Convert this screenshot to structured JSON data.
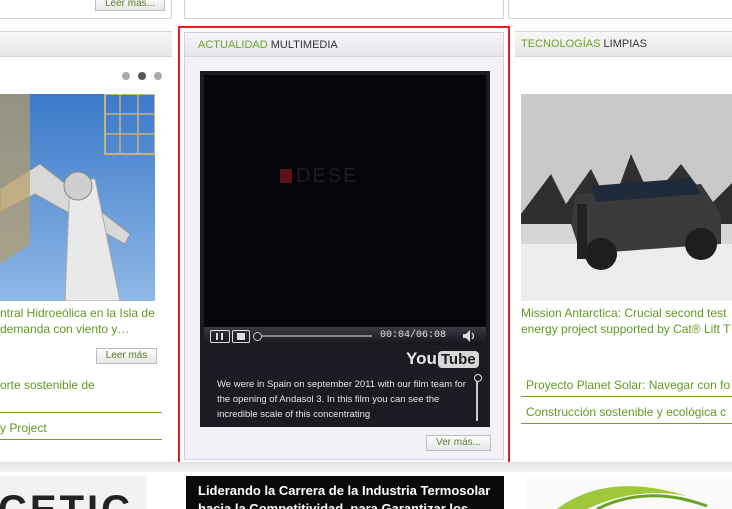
{
  "top": {
    "leer_label": "Leer más..."
  },
  "left": {
    "news_title": "...ntral Hidroeólica en la Isla de ... demanda con viento y…",
    "news_line1": "ntral Hidroeólica en la Isla de",
    "news_line2": "demanda con viento y…",
    "leer_label": "Leer más",
    "links": [
      "orte sostenible de",
      "y Project"
    ]
  },
  "center": {
    "heading_green": "ACTUALIDAD",
    "heading_dark": "MULTIMEDIA",
    "video": {
      "time_current": "00:04",
      "time_total": "06:08",
      "logo_you": "You",
      "logo_tube": "Tube",
      "overlay_text": "DESE",
      "description": "We were in Spain on september 2011 with our film team for the opening of Andasol 3. In this film you can see the incredible scale of this concentrating"
    },
    "ver_mas_label": "Ver más..."
  },
  "right": {
    "heading_green": "TECNOLOGÍAS",
    "heading_dark": "LIMPIAS",
    "news_line1": "Mission Antarctica: Crucial second test",
    "news_line2": "energy project supported by Cat® Lift T",
    "links": [
      "Proyecto Planet Solar: Navegar con fo",
      "Construcción sostenible y ecológica c"
    ]
  },
  "bottom": {
    "left_logo": "CETIC",
    "banner_line1": "Liderando la Carrera de la Industria Termosolar",
    "banner_line2": "hacia la Competitividad, para Garantizar los"
  },
  "colors": {
    "highlight": "#e21e1e",
    "accent": "#6aa325"
  }
}
